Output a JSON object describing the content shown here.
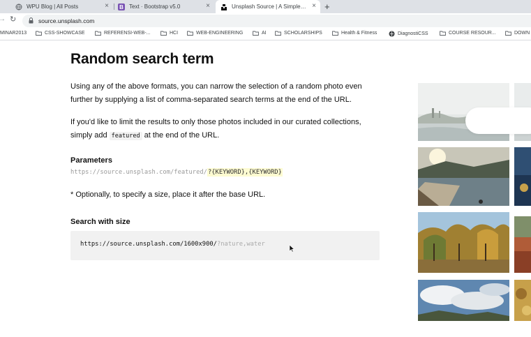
{
  "browser": {
    "tabs": [
      {
        "title": "WPU Blog | All Posts",
        "icon": "globe-icon",
        "active": false
      },
      {
        "title": "Text · Bootstrap v5.0",
        "icon": "bootstrap-icon",
        "active": false
      },
      {
        "title": "Unsplash Source | A Simple AP",
        "icon": "unsplash-icon",
        "active": true
      }
    ],
    "new_tab_label": "+",
    "close_label": "×",
    "url": "source.unsplash.com",
    "bookmarks": [
      {
        "label": "MINAR2013",
        "icon": "none"
      },
      {
        "label": "CSS-SHOWCASE",
        "icon": "folder-icon"
      },
      {
        "label": "REFERENSI-WEB-...",
        "icon": "folder-icon"
      },
      {
        "label": "HCI",
        "icon": "folder-icon"
      },
      {
        "label": "WEB-ENGINEERING",
        "icon": "folder-icon"
      },
      {
        "label": "AI",
        "icon": "folder-icon"
      },
      {
        "label": "SCHOLARSHIPS",
        "icon": "folder-icon"
      },
      {
        "label": "Health & Fitness",
        "icon": "folder-icon"
      },
      {
        "label": "DiagnostiCSS",
        "icon": "globe-icon"
      },
      {
        "label": "COURSE RESOUR...",
        "icon": "folder-icon"
      },
      {
        "label": "DOWN",
        "icon": "folder-icon"
      }
    ]
  },
  "content": {
    "heading": "Random search term",
    "paragraph1": "Using any of the above formats, you can narrow the selection of a random photo even further by supplying a list of comma-separated search terms at the end of the URL.",
    "paragraph2_before": "If you'd like to limit the results to only those photos included in our curated collections, simply add",
    "paragraph2_code": "featured",
    "paragraph2_after": "at the end of the URL.",
    "parameters_heading": "Parameters",
    "parameters_url": "https://source.unsplash.com/featured/",
    "parameters_keywords": "?{KEYWORD},{KEYWORD}",
    "note": "* Optionally, to specify a size, place it after the base URL.",
    "size_heading": "Search with size",
    "size_url": "https://source.unsplash.com/1600x900/",
    "size_query": "?nature,water"
  },
  "colors": {
    "tab_bar": "#dee1e6",
    "keyword_highlight": "#fdfbd1",
    "code_bg": "#f1f1f1"
  }
}
